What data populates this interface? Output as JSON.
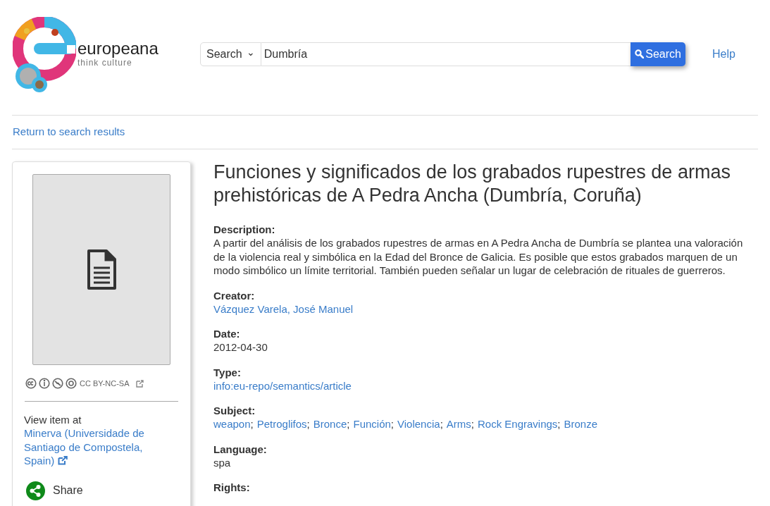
{
  "logo": {
    "name": "europeana",
    "tagline": "think culture"
  },
  "search": {
    "scope": "Search",
    "caret": "⌄",
    "value": "Dumbría",
    "button": "Search"
  },
  "help": "Help",
  "back_link": "Return to search results",
  "sidebar": {
    "license": "CC BY-NC-SA",
    "view_label": "View item at",
    "provider": "Minerva (Universidade de Santiago de Compostela, Spain)",
    "share": "Share"
  },
  "title": "Funciones y significados de los grabados rupestres de armas prehistóricas de A Pedra Ancha (Dumbría, Coruña)",
  "fields": [
    {
      "label": "Description:",
      "kind": "text",
      "values": [
        "A partir del análisis de los grabados rupestres de armas en A Pedra Ancha de Dumbría se plantea una valoración de la violencia real y simbólica en la Edad del Bronce de Galicia. Es posible que estos grabados marquen de un modo simbólico un límite territorial. También pueden señalar un lugar de celebración de rituales de guerreros."
      ]
    },
    {
      "label": "Creator:",
      "kind": "link",
      "values": [
        "Vázquez Varela, José Manuel"
      ]
    },
    {
      "label": "Date:",
      "kind": "text",
      "values": [
        "2012-04-30"
      ]
    },
    {
      "label": "Type:",
      "kind": "link",
      "values": [
        "info:eu-repo/semantics/article"
      ]
    },
    {
      "label": "Subject:",
      "kind": "link",
      "separator": ";",
      "values": [
        "weapon",
        "Petroglifos",
        "Bronce",
        "Función",
        "Violencia",
        "Arms",
        "Rock Engravings",
        "Bronze"
      ]
    },
    {
      "label": "Language:",
      "kind": "text",
      "values": [
        "spa"
      ]
    },
    {
      "label": "Rights:"
    }
  ]
}
